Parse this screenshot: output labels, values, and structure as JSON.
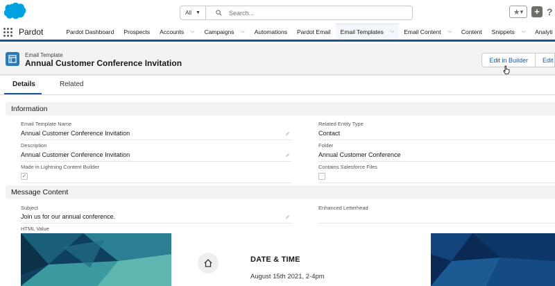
{
  "global_header": {
    "search_scope": "All",
    "search_placeholder": "Search..."
  },
  "nav": {
    "app_name": "Pardot",
    "items": [
      {
        "label": "Pardot Dashboard",
        "has_menu": false
      },
      {
        "label": "Prospects",
        "has_menu": false
      },
      {
        "label": "Accounts",
        "has_menu": true
      },
      {
        "label": "Campaigns",
        "has_menu": true
      },
      {
        "label": "Automations",
        "has_menu": false
      },
      {
        "label": "Pardot Email",
        "has_menu": false
      },
      {
        "label": "Email Templates",
        "has_menu": true,
        "active": true
      },
      {
        "label": "Email Content",
        "has_menu": true
      },
      {
        "label": "Content",
        "has_menu": false
      },
      {
        "label": "Snippets",
        "has_menu": true
      },
      {
        "label": "Analyti",
        "has_menu": false
      }
    ]
  },
  "record": {
    "type_label": "Email Template",
    "title": "Annual Customer Conference Invitation",
    "buttons": {
      "edit_in_builder": "Edit in Builder",
      "edit": "Edit"
    }
  },
  "tabs": {
    "details": "Details",
    "related": "Related"
  },
  "information": {
    "heading": "Information",
    "email_template_name_label": "Email Template Name",
    "email_template_name": "Annual Customer Conference Invitation",
    "description_label": "Description",
    "description": "Annual Customer Conference Invitation",
    "lightning_builder_label": "Made in Lightning Content Builder",
    "lightning_builder_checked": true,
    "related_entity_type_label": "Related Entity Type",
    "related_entity_type": "Contact",
    "folder_label": "Folder",
    "folder": "Annual Customer Conference",
    "salesforce_files_label": "Contains Salesforce Files",
    "salesforce_files_checked": false
  },
  "message_content": {
    "heading": "Message Content",
    "subject_label": "Subject",
    "subject": "Join us for our annual conference.",
    "letterhead_label": "Enhanced Letterhead",
    "html_value_label": "HTML Value",
    "preview": {
      "date_heading": "DATE & TIME",
      "date_value": "August 15th 2021, 2-4pm"
    }
  },
  "colors": {
    "brand_blue": "#1b5297",
    "link_blue": "#0b5cab",
    "record_icon": "#2a7ab8",
    "salesforce_cloud": "#00a1e0"
  }
}
